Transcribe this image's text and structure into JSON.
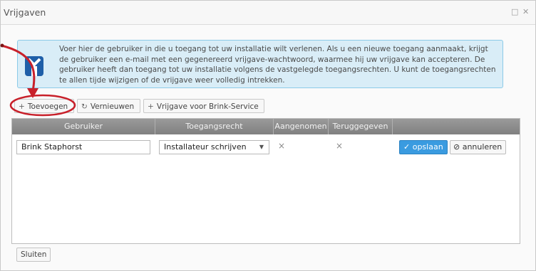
{
  "window": {
    "title": "Vrijgaven",
    "minimize_icon": "maximize-icon",
    "close_icon": "close-icon"
  },
  "info": {
    "text": "Voer hier de gebruiker in die u toegang tot uw installatie wilt verlenen. Als u een nieuwe toegang aanmaakt, krijgt de gebruiker een e-mail met een gegenereerd vrijgave-wachtwoord, waarmee hij uw vrijgave kan accepteren. De gebruiker heeft dan toegang tot uw installatie volgens de vastgelegde toegangsrechten. U kunt de toegangsrechten te allen tijde wijzigen of de vrijgave weer volledig intrekken.",
    "icon": "info-icon"
  },
  "toolbar": {
    "add_label": "Toevoegen",
    "refresh_label": "Vernieuwen",
    "brink_label": "Vrijgave voor Brink-Service"
  },
  "grid": {
    "columns": [
      "Gebruiker",
      "Toegangsrecht",
      "Aangenomen",
      "Teruggegeven",
      ""
    ],
    "row": {
      "user": "Brink Staphorst",
      "access": "Installateur schrijven",
      "accepted": "×",
      "returned": "×",
      "save_label": "opslaan",
      "cancel_label": "annuleren"
    }
  },
  "footer": {
    "close_label": "Sluiten"
  },
  "colors": {
    "annotation": "#c8202a",
    "save_button": "#3a9be0",
    "info_background": "#d9edf7"
  }
}
